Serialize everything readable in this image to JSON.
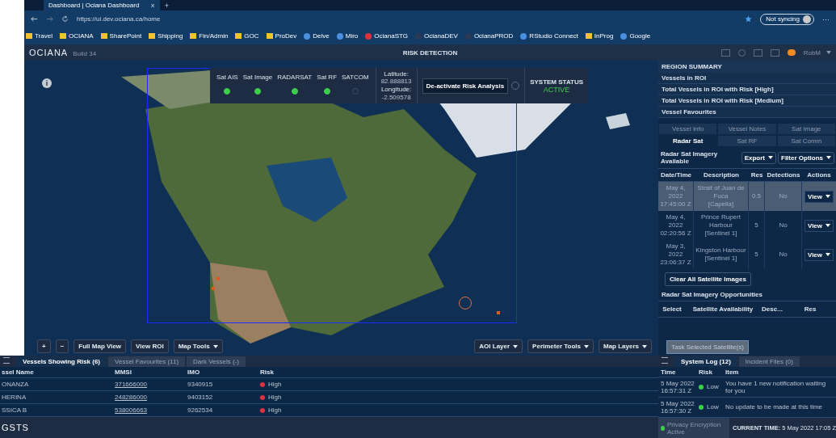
{
  "browser": {
    "tab_title": "Dashboard | Ociana Dashboard",
    "close": "×",
    "new_tab": "+",
    "url": "https://ui.dev.ociana.ca/home",
    "sync": "Not syncing",
    "more": "···",
    "bookmarks": [
      {
        "label": "Travel",
        "kind": "folder"
      },
      {
        "label": "OCIANA",
        "kind": "folder"
      },
      {
        "label": "SharePoint",
        "kind": "folder"
      },
      {
        "label": "Shipping",
        "kind": "folder"
      },
      {
        "label": "Fin/Admin",
        "kind": "folder"
      },
      {
        "label": "GOC",
        "kind": "folder"
      },
      {
        "label": "ProDev",
        "kind": "folder"
      },
      {
        "label": "Delve",
        "kind": "app"
      },
      {
        "label": "Miro",
        "kind": "app"
      },
      {
        "label": "OcianaSTG",
        "kind": "pin"
      },
      {
        "label": "OcianaDEV",
        "kind": "site"
      },
      {
        "label": "OcianaPROD",
        "kind": "site"
      },
      {
        "label": "RStudio Connect",
        "kind": "app"
      },
      {
        "label": "InProg",
        "kind": "folder"
      },
      {
        "label": "Google",
        "kind": "app"
      }
    ]
  },
  "app_header": {
    "logo": "OCIANA",
    "build": "Build 34",
    "title": "RISK DETECTION",
    "user": "RobM"
  },
  "info_button": "i",
  "status_panel": {
    "feeds": [
      {
        "label": "Sat AIS",
        "on": true
      },
      {
        "label": "Sat Image",
        "on": true
      },
      {
        "label": "RADARSAT",
        "on": true
      },
      {
        "label": "Sat RF",
        "on": true
      },
      {
        "label": "SATCOM",
        "on": false
      }
    ],
    "latitude_label": "Latitude:",
    "latitude": "82.888813",
    "longitude_label": "Longitude:",
    "longitude": "-2.509578",
    "deactivate_button": "De-activate Risk Analysis",
    "system_status_label": "SYSTEM STATUS",
    "system_status": "ACTIVE"
  },
  "map_controls": {
    "zoom_in": "+",
    "zoom_out": "−",
    "buttons": [
      {
        "label": "Full Map View",
        "dropdown": false
      },
      {
        "label": "View ROI",
        "dropdown": false
      },
      {
        "label": "Map Tools",
        "dropdown": true
      }
    ],
    "layer_buttons": [
      "AOI Layer",
      "Perimeter Tools",
      "Map Layers"
    ]
  },
  "region_summary": {
    "title": "REGION SUMMARY",
    "rows": [
      "Vessels in ROI",
      "Total Vessels in ROI with Risk [High]",
      "Total Vessels in ROI with Risk [Medium]",
      "Vessel Favourites"
    ]
  },
  "detail_tabs": [
    {
      "label": "Vessel Info",
      "selected": false
    },
    {
      "label": "Vessel Notes",
      "selected": false
    },
    {
      "label": "Sat Image",
      "selected": false
    },
    {
      "label": "Radar Sat",
      "selected": true
    },
    {
      "label": "Sat RF",
      "selected": false
    },
    {
      "label": "Sat Comm",
      "selected": false
    }
  ],
  "imagery": {
    "title": "Radar Sat Imagery Available",
    "export": "Export",
    "filter": "Filter Options",
    "columns": [
      "Date/Time",
      "Description",
      "Res",
      "Detections",
      "Actions"
    ],
    "rows": [
      {
        "date": "May 4, 2022",
        "time": "17:45:00 Z",
        "place": "Strait of Juan de Fuca",
        "source": "[Capella]",
        "res": "0.5",
        "detections": "No",
        "action": "View",
        "selected": true
      },
      {
        "date": "May 4, 2022",
        "time": "02:20:56 Z",
        "place": "Prince Rupert Harbour",
        "source": "[Sentinel 1]",
        "res": "5",
        "detections": "No",
        "action": "View",
        "selected": false
      },
      {
        "date": "May 3, 2022",
        "time": "23:06:37 Z",
        "place": "Kingston Harbour",
        "source": "[Sentinel 1]",
        "res": "5",
        "detections": "No",
        "action": "View",
        "selected": false
      }
    ],
    "clear_button": "Clear All Satellite Images"
  },
  "opportunities": {
    "title": "Radar Sat Imagery Opportunities",
    "columns": [
      "Select",
      "Satellite Availability",
      "Desc...",
      "Res"
    ],
    "task_button": "Task Selected Satellite(s)",
    "task_disabled": true
  },
  "vessel_tabs": [
    {
      "label": "Vessels Showing Risk (6)",
      "selected": true
    },
    {
      "label": "Vessel Favourites (11)",
      "selected": false
    },
    {
      "label": "Dark Vessels (-)",
      "selected": false
    }
  ],
  "vessel_table": {
    "columns": [
      "ssel Name",
      "MMSI",
      "IMO",
      "Risk"
    ],
    "rows": [
      {
        "name": "ONANZA",
        "mmsi": "371666000",
        "imo": "9340915",
        "risk": "High",
        "color": "#e0303a"
      },
      {
        "name": "HERINA",
        "mmsi": "248286000",
        "imo": "9403152",
        "risk": "High",
        "color": "#e0303a"
      },
      {
        "name": "SSICA B",
        "mmsi": "538006663",
        "imo": "9262534",
        "risk": "High",
        "color": "#e0303a"
      }
    ]
  },
  "footer_left": "GSTS",
  "log_tabs": [
    {
      "label": "System Log (12)",
      "selected": true
    },
    {
      "label": "Incident Files (0)",
      "selected": false
    }
  ],
  "log_table": {
    "columns": [
      "Time",
      "Risk",
      "Item"
    ],
    "rows": [
      {
        "date": "5 May 2022",
        "time": "16:57:31 Z",
        "risk": "Low",
        "color": "#3ecf4a",
        "item": "You have 1 new notification waiting for you"
      },
      {
        "date": "5 May 2022",
        "time": "16:57:30 Z",
        "risk": "Low",
        "color": "#3ecf4a",
        "item": "No update to be made at this time"
      }
    ]
  },
  "footer_right": {
    "privacy": "Privacy Encryption Active",
    "time_label": "CURRENT TIME:",
    "time": "5 May 2022 17:05 Z"
  }
}
